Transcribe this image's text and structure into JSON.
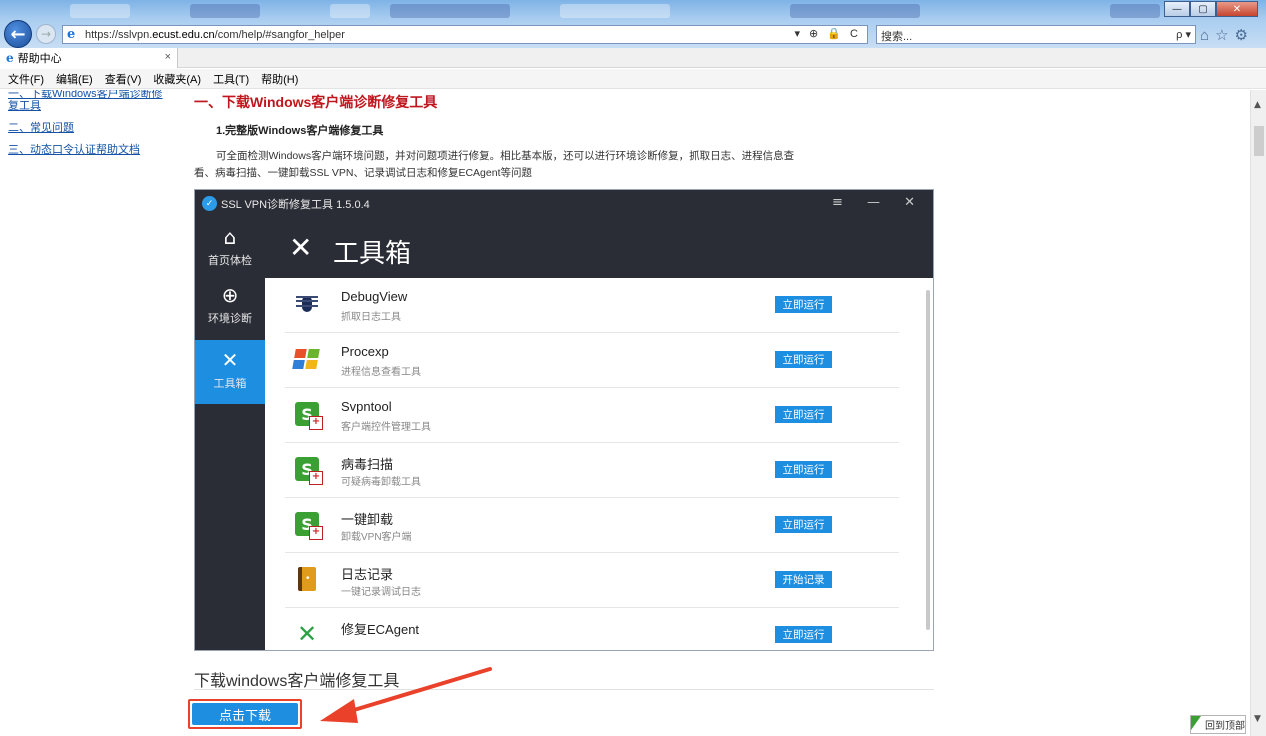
{
  "browser": {
    "url_prefix": "https://sslvpn.",
    "url_host": "ecust.edu.cn",
    "url_path": "/com/help/#sangfor_helper",
    "address_tools": "▾ ⊕ 🔒 C",
    "search_placeholder": "搜索...",
    "search_icon": "ρ ▾",
    "tab_title": "帮助中心",
    "tab_close": "×",
    "window_controls": {
      "minimize": "—",
      "maximize": "▢",
      "close": "✕"
    },
    "menu": [
      "文件(F)",
      "编辑(E)",
      "查看(V)",
      "收藏夹(A)",
      "工具(T)",
      "帮助(H)"
    ]
  },
  "leftnav": {
    "items": [
      "一、下载Windows客户端诊断修复工具",
      "二、常见问题",
      "三、动态口令认证帮助文档"
    ]
  },
  "content": {
    "section_title": "一、下载Windows客户端诊断修复工具",
    "sub_title": "1.完整版Windows客户端修复工具",
    "description": "可全面检测Windows客户端环境问题，并对问题项进行修复。相比基本版，还可以进行环境诊断修复，抓取日志、进程信息查看、病毒扫描、一键卸载SSL VPN、记录调试日志和修复ECAgent等问题",
    "download_title": "下载windows客户端修复工具",
    "download_button": "点击下载",
    "back_to_top": "回到顶部"
  },
  "app": {
    "title": "SSL VPN诊断修复工具 1.5.0.4",
    "window_controls": "≡ — ✕",
    "header": "工具箱",
    "side": [
      {
        "label": "首页体检",
        "icon": "home-icon"
      },
      {
        "label": "环境诊断",
        "icon": "globe-icon"
      },
      {
        "label": "工具箱",
        "icon": "tools-icon"
      }
    ],
    "tools": [
      {
        "name": "DebugView",
        "desc": "抓取日志工具",
        "button": "立即运行",
        "icon": "bug-icon"
      },
      {
        "name": "Procexp",
        "desc": "进程信息查看工具",
        "button": "立即运行",
        "icon": "windows-icon"
      },
      {
        "name": "Svpntool",
        "desc": "客户端控件管理工具",
        "button": "立即运行",
        "icon": "svpn-icon"
      },
      {
        "name": "病毒扫描",
        "desc": "可疑病毒卸载工具",
        "button": "立即运行",
        "icon": "svpn-icon"
      },
      {
        "name": "一键卸载",
        "desc": "卸载VPN客户端",
        "button": "立即运行",
        "icon": "svpn-icon"
      },
      {
        "name": "日志记录",
        "desc": "一键记录调试日志",
        "button": "开始记录",
        "icon": "log-icon"
      },
      {
        "name": "修复ECAgent",
        "desc": "",
        "button": "立即运行",
        "icon": "wrench-icon"
      }
    ]
  },
  "colors": {
    "accent": "#1e8ee0",
    "app_dark": "#2a2d36",
    "title_red": "#c0171e",
    "highlight": "#e9412a"
  }
}
